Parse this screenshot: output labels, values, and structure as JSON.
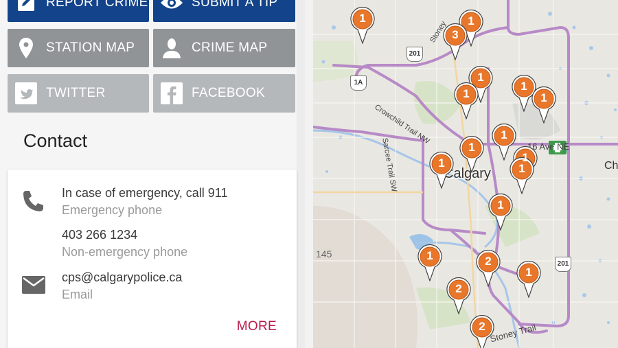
{
  "tiles": {
    "report_crime": "REPORT CRIME",
    "submit_tip": "SUBMIT A TIP",
    "station_map": "STATION MAP",
    "crime_map": "CRIME MAP",
    "twitter": "TWITTER",
    "facebook": "FACEBOOK"
  },
  "contact": {
    "heading": "Contact",
    "emergency_primary": "In case of emergency, call 911",
    "emergency_secondary": "Emergency phone",
    "nonemergency_primary": "403 266 1234",
    "nonemergency_secondary": "Non-emergency phone",
    "email_primary": "cps@calgarypolice.ca",
    "email_secondary": "Email",
    "more": "MORE"
  },
  "map": {
    "city": "Calgary",
    "far_label": "Ch",
    "num_label": "145",
    "roads": {
      "crowchild": "Crowchild Trail NW",
      "sarcee": "Sarcee Trail SW",
      "stoney_south": "Stoney Trail",
      "stoney_north": "Stoney",
      "ave16": "16 Ave NE"
    },
    "shields": {
      "s201a": "201",
      "s1a": "1A",
      "s201b": "201"
    },
    "pins": [
      "1",
      "1",
      "3",
      "1",
      "1",
      "1",
      "1",
      "1",
      "1",
      "1",
      "1",
      "1",
      "1",
      "2",
      "1",
      "1",
      "2"
    ]
  },
  "colors": {
    "brand_blue": "#13438a",
    "tile_grey": "#909497",
    "tile_light_grey": "#b4b8bb",
    "more_link": "#b81b49",
    "pin_orange": "#e8772b",
    "road_purple": "#b78ac7"
  }
}
